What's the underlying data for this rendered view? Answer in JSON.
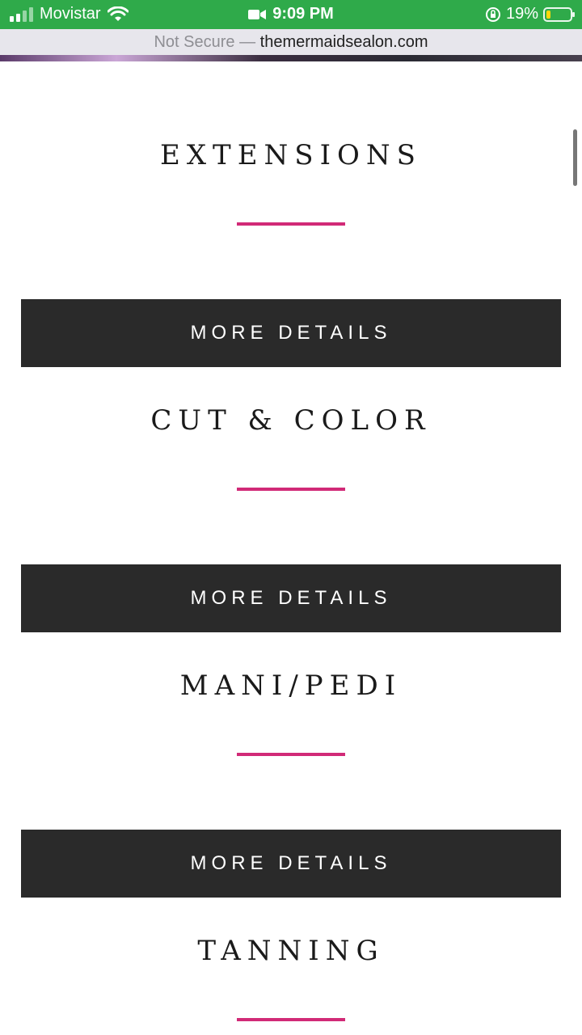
{
  "status_bar": {
    "carrier": "Movistar",
    "time": "9:09 PM",
    "battery": "19%",
    "battery_level": 0.19,
    "colors": {
      "background": "#2faa4a",
      "battery_fill": "#ffd60a"
    },
    "icons": [
      "signal-icon",
      "wifi-icon",
      "camera-icon",
      "orientation-lock-icon",
      "battery-icon"
    ]
  },
  "url_bar": {
    "security": "Not Secure —",
    "domain": "themermaidsealon.com"
  },
  "services": [
    {
      "title": "EXTENSIONS",
      "button": "MORE DETAILS"
    },
    {
      "title": "CUT & COLOR",
      "button": "MORE DETAILS"
    },
    {
      "title": "MANI/PEDI",
      "button": "MORE DETAILS"
    },
    {
      "title": "TANNING"
    }
  ],
  "colors": {
    "accent": "#d12a77",
    "button_bg": "#2a2a2a"
  }
}
